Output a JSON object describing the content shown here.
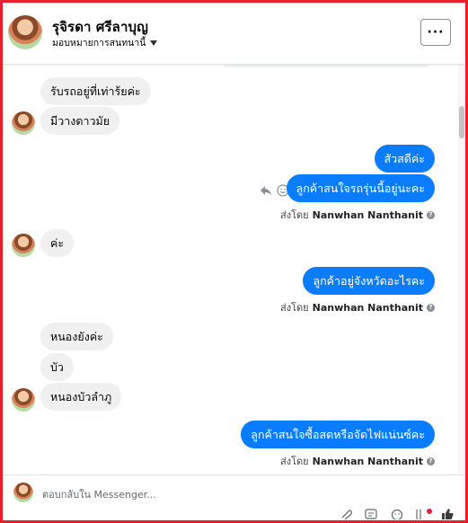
{
  "header": {
    "name": "รุจิรดา ศรีลาบุญ",
    "subtitle": "มอบหมายการสนทนานี้",
    "more_label": "···"
  },
  "messages": [
    {
      "direction": "in",
      "text": "รับรถอยู่ที่เท่าร้ยค่ะ"
    },
    {
      "direction": "in",
      "text": "มีวางดาวมัย"
    },
    {
      "direction": "out",
      "text": "สัวสดีค่ะ"
    },
    {
      "direction": "out",
      "text": "ลูกค้าสนใจรถรุ่นนี้อยู่นะคะ"
    },
    {
      "direction": "in",
      "text": "ค่ะ"
    },
    {
      "direction": "out",
      "text": "ลูกค้าอยู่จังหวัดอะไรคะ"
    },
    {
      "direction": "in",
      "text": "หนองยังค่ะ"
    },
    {
      "direction": "in",
      "text": "บัว"
    },
    {
      "direction": "in",
      "text": "หนองบัวลำภู"
    },
    {
      "direction": "out",
      "text": "ลูกค้าสนใจซื้อสดหรือจัดไฟแน่นซ์คะ"
    }
  ],
  "sent_by": {
    "prefix": "ส่งโดย",
    "agent": "Nanwhan Nanthanit"
  },
  "composer": {
    "placeholder": "ตอบกลับใน Messenger..."
  },
  "colors": {
    "outgoing": "#0a7cff",
    "incoming": "#f0f0f0",
    "frame": "#e8202a"
  }
}
